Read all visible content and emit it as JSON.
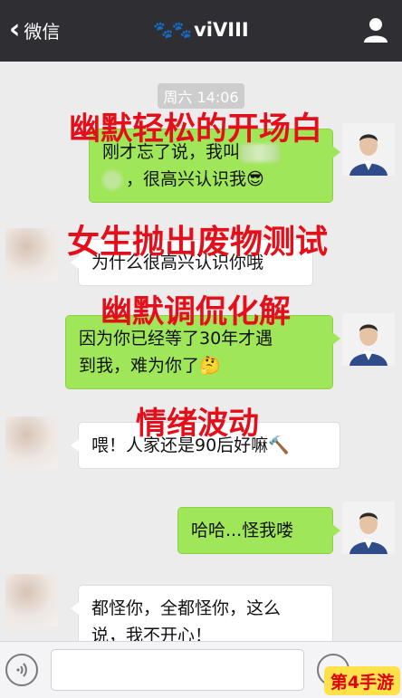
{
  "header": {
    "back_label": "微信",
    "contact_name": "viVIII",
    "title_decoration": "🐾🐾"
  },
  "chat": {
    "timestamp": "周六 14:06",
    "messages": [
      {
        "side": "right",
        "lines": [
          "刚才忘了说，我叫",
          "，很高兴认识我😎"
        ]
      },
      {
        "side": "left",
        "lines": [
          "为什么很高兴认识你哦"
        ]
      },
      {
        "side": "right",
        "lines": [
          "因为你已经等了30年才遇",
          "到我，难为你了🤔"
        ]
      },
      {
        "side": "left",
        "lines": [
          "喂！人家还是90后好嘛🔨"
        ]
      },
      {
        "side": "right",
        "lines": [
          "哈哈...怪我喽"
        ]
      },
      {
        "side": "left",
        "lines": [
          "都怪你，全都怪你，这么",
          "说，我不开心！"
        ]
      }
    ]
  },
  "overlays": [
    "幽默轻松的开场白",
    "女生抛出废物测试",
    "幽默调侃化解",
    "情绪波动"
  ],
  "watermark": "第4手游",
  "colors": {
    "header_bg": "#2f2f33",
    "chat_bg": "#ececec",
    "bubble_green": "#9fe658",
    "overlay_red": "#e3101b"
  },
  "icons": {
    "back": "chevron-left-icon",
    "profile": "person-icon",
    "voice": "voice-icon",
    "emoji": "smiley-icon"
  }
}
